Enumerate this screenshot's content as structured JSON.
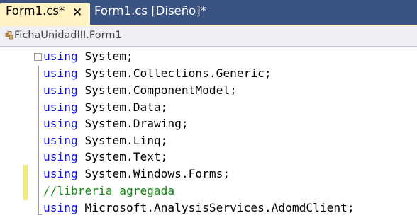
{
  "tabs": [
    {
      "label": "Form1.cs*",
      "active": true
    },
    {
      "label": "Form1.cs [Diseño]*",
      "active": false
    }
  ],
  "tab_close_glyph": "✕",
  "navigation": {
    "label": "FichaUnidadIII.Form1",
    "icon": "class-icon"
  },
  "code": [
    {
      "type": "using",
      "keyword": "using",
      "name": "System;"
    },
    {
      "type": "using",
      "keyword": "using",
      "name": "System.Collections.Generic;"
    },
    {
      "type": "using",
      "keyword": "using",
      "name": "System.ComponentModel;"
    },
    {
      "type": "using",
      "keyword": "using",
      "name": "System.Data;"
    },
    {
      "type": "using",
      "keyword": "using",
      "name": "System.Drawing;"
    },
    {
      "type": "using",
      "keyword": "using",
      "name": "System.Linq;"
    },
    {
      "type": "using",
      "keyword": "using",
      "name": "System.Text;"
    },
    {
      "type": "using",
      "keyword": "using",
      "name": "System.Windows.Forms;"
    },
    {
      "type": "comment",
      "text": "//libreria agregada"
    },
    {
      "type": "using",
      "keyword": "using",
      "name": "Microsoft.AnalysisServices.AdomdClient;"
    }
  ],
  "colors": {
    "keyword": "#1111ee",
    "comment": "#118811",
    "tab_bar": "#3b5382",
    "active_tab": "#fff3c4",
    "change_marker": "#f4eb77"
  }
}
